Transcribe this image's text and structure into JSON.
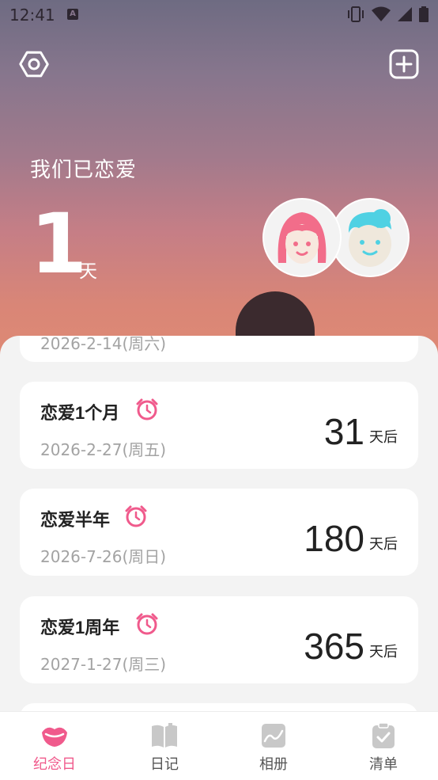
{
  "status_bar": {
    "time": "12:41",
    "a_badge": "A"
  },
  "header": {
    "title": "我们已恋爱",
    "count": "1",
    "unit": "天"
  },
  "anniversaries": [
    {
      "title": "",
      "date": "2026-2-14(周六)",
      "count": "",
      "unit": ""
    },
    {
      "title": "恋爱1个月",
      "date": "2026-2-27(周五)",
      "count": "31",
      "unit": "天后"
    },
    {
      "title": "恋爱半年",
      "date": "2026-7-26(周日)",
      "count": "180",
      "unit": "天后"
    },
    {
      "title": "恋爱1周年",
      "date": "2027-1-27(周三)",
      "count": "365",
      "unit": "天后"
    }
  ],
  "tabs": [
    {
      "label": "纪念日",
      "icon": "lips-icon",
      "active": true
    },
    {
      "label": "日记",
      "icon": "book-icon",
      "active": false
    },
    {
      "label": "相册",
      "icon": "photo-icon",
      "active": false
    },
    {
      "label": "清单",
      "icon": "checklist-icon",
      "active": false
    }
  ],
  "colors": {
    "accent": "#f05a8c",
    "inactive_icon": "#c8c8c8"
  }
}
